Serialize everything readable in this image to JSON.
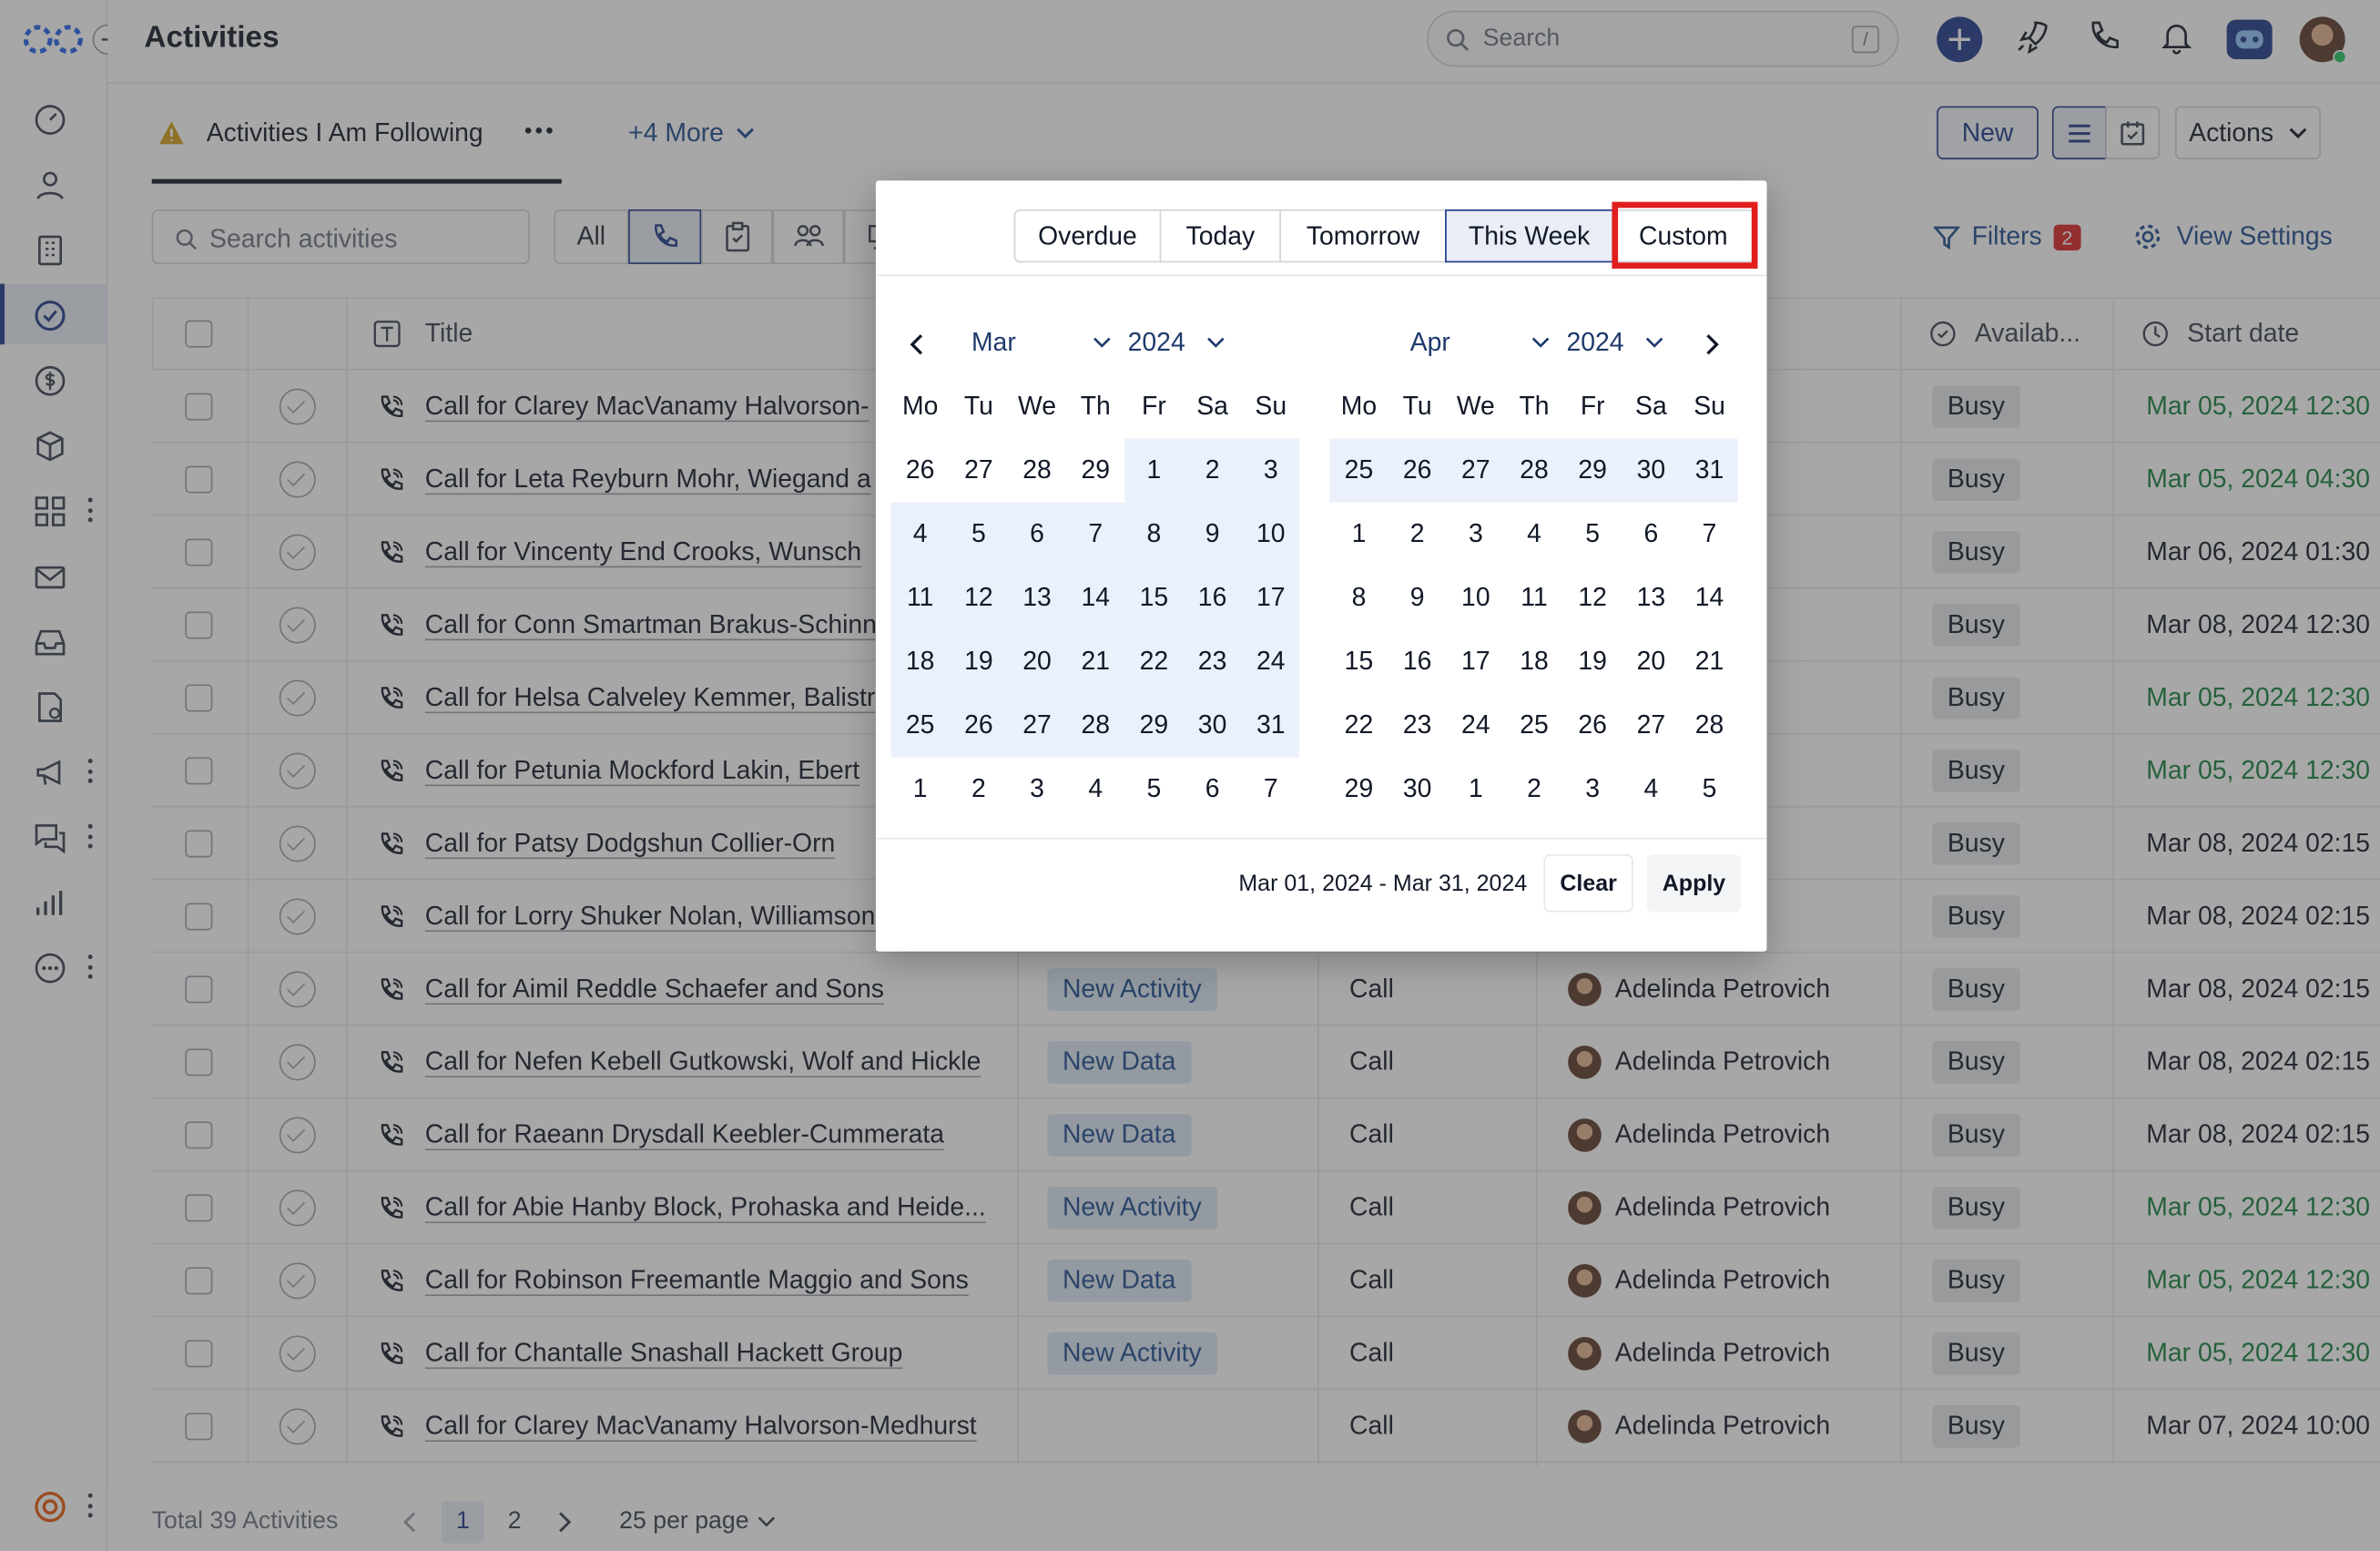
{
  "app": {
    "title": "Activities"
  },
  "search": {
    "placeholder": "Search",
    "shortcut": "/"
  },
  "view": {
    "active_tab": "Activities I Am Following",
    "more_views": "+4 More",
    "new_label": "New",
    "actions_label": "Actions"
  },
  "toolbar": {
    "search_placeholder": "Search activities",
    "all_label": "All",
    "filters_label": "Filters",
    "filters_count": "2",
    "view_settings_label": "View Settings"
  },
  "columns": {
    "title": "Title",
    "availability": "Availab...",
    "start_date": "Start date"
  },
  "rows": [
    {
      "title": "Call for Clarey MacVanamy Halvorson-",
      "tag": "",
      "type": "",
      "owner": "trovich",
      "availability": "Busy",
      "start": "Mar 05, 2024 12:30",
      "start_color": "#15803d"
    },
    {
      "title": "Call for Leta Reyburn Mohr, Wiegand a",
      "tag": "",
      "type": "",
      "owner": "trovich",
      "availability": "Busy",
      "start": "Mar 05, 2024 04:30",
      "start_color": "#15803d"
    },
    {
      "title": "Call for Vincenty End Crooks, Wunsch",
      "tag": "",
      "type": "",
      "owner": "trovich",
      "availability": "Busy",
      "start": "Mar 06, 2024 01:30",
      "start_color": "#111827"
    },
    {
      "title": "Call for Conn Smartman Brakus-Schinn",
      "tag": "",
      "type": "",
      "owner": "trovich",
      "availability": "Busy",
      "start": "Mar 08, 2024 12:30",
      "start_color": "#111827"
    },
    {
      "title": "Call for Helsa Calveley Kemmer, Balistr",
      "tag": "",
      "type": "",
      "owner": "trovich",
      "availability": "Busy",
      "start": "Mar 05, 2024 12:30",
      "start_color": "#15803d"
    },
    {
      "title": "Call for Petunia Mockford Lakin, Ebert",
      "tag": "",
      "type": "",
      "owner": "trovich",
      "availability": "Busy",
      "start": "Mar 05, 2024 12:30",
      "start_color": "#15803d"
    },
    {
      "title": "Call for Patsy Dodgshun Collier-Orn",
      "tag": "",
      "type": "",
      "owner": "trovich",
      "availability": "Busy",
      "start": "Mar 08, 2024 02:15",
      "start_color": "#111827"
    },
    {
      "title": "Call for Lorry Shuker Nolan, Williamson",
      "tag": "",
      "type": "",
      "owner": "trovich",
      "availability": "Busy",
      "start": "Mar 08, 2024 02:15",
      "start_color": "#111827"
    },
    {
      "title": "Call for Aimil Reddle Schaefer and Sons",
      "tag": "New Activity",
      "type": "Call",
      "owner": "Adelinda Petrovich",
      "availability": "Busy",
      "start": "Mar 08, 2024 02:15",
      "start_color": "#111827"
    },
    {
      "title": "Call for Nefen Kebell Gutkowski, Wolf and Hickle",
      "tag": "New Data",
      "type": "Call",
      "owner": "Adelinda Petrovich",
      "availability": "Busy",
      "start": "Mar 08, 2024 02:15",
      "start_color": "#111827"
    },
    {
      "title": "Call for Raeann Drysdall Keebler-Cummerata",
      "tag": "New Data",
      "type": "Call",
      "owner": "Adelinda Petrovich",
      "availability": "Busy",
      "start": "Mar 08, 2024 02:15",
      "start_color": "#111827"
    },
    {
      "title": "Call for Abie Hanby Block, Prohaska and Heide...",
      "tag": "New Activity",
      "type": "Call",
      "owner": "Adelinda Petrovich",
      "availability": "Busy",
      "start": "Mar 05, 2024 12:30",
      "start_color": "#15803d"
    },
    {
      "title": "Call for Robinson Freemantle Maggio and Sons",
      "tag": "New Data",
      "type": "Call",
      "owner": "Adelinda Petrovich",
      "availability": "Busy",
      "start": "Mar 05, 2024 12:30",
      "start_color": "#15803d"
    },
    {
      "title": "Call for Chantalle Snashall Hackett Group",
      "tag": "New Activity",
      "type": "Call",
      "owner": "Adelinda Petrovich",
      "availability": "Busy",
      "start": "Mar 05, 2024 12:30",
      "start_color": "#15803d"
    },
    {
      "title": "Call for Clarey MacVanamy Halvorson-Medhurst",
      "tag": "",
      "type": "Call",
      "owner": "Adelinda Petrovich",
      "availability": "Busy",
      "start": "Mar 07, 2024 10:00",
      "start_color": "#111827"
    }
  ],
  "footer": {
    "total": "Total 39 Activities",
    "pages": [
      "1",
      "2"
    ],
    "current_page": "1",
    "per_page": "25 per page"
  },
  "popup": {
    "quick": [
      "Overdue",
      "Today",
      "Tomorrow",
      "This Week",
      "Custom"
    ],
    "quick_active": "This Week",
    "left": {
      "month": "Mar",
      "year": "2024"
    },
    "right": {
      "month": "Apr",
      "year": "2024"
    },
    "dow": [
      "Mo",
      "Tu",
      "We",
      "Th",
      "Fr",
      "Sa",
      "Su"
    ],
    "left_days": [
      [
        "26",
        "27",
        "28",
        "29",
        "1",
        "2",
        "3"
      ],
      [
        "4",
        "5",
        "6",
        "7",
        "8",
        "9",
        "10"
      ],
      [
        "11",
        "12",
        "13",
        "14",
        "15",
        "16",
        "17"
      ],
      [
        "18",
        "19",
        "20",
        "21",
        "22",
        "23",
        "24"
      ],
      [
        "25",
        "26",
        "27",
        "28",
        "29",
        "30",
        "31"
      ],
      [
        "1",
        "2",
        "3",
        "4",
        "5",
        "6",
        "7"
      ]
    ],
    "right_days": [
      [
        "25",
        "26",
        "27",
        "28",
        "29",
        "30",
        "31"
      ],
      [
        "1",
        "2",
        "3",
        "4",
        "5",
        "6",
        "7"
      ],
      [
        "8",
        "9",
        "10",
        "11",
        "12",
        "13",
        "14"
      ],
      [
        "15",
        "16",
        "17",
        "18",
        "19",
        "20",
        "21"
      ],
      [
        "22",
        "23",
        "24",
        "25",
        "26",
        "27",
        "28"
      ],
      [
        "29",
        "30",
        "1",
        "2",
        "3",
        "4",
        "5"
      ]
    ],
    "range_label": "Mar 01, 2024 - Mar 31, 2024",
    "clear_label": "Clear",
    "apply_label": "Apply"
  },
  "colors": {
    "brand": "#1e3a8a",
    "highlight": "#e11d1d",
    "range_bg": "#eaf1fb",
    "tag_bg": "#dbe8f5"
  }
}
